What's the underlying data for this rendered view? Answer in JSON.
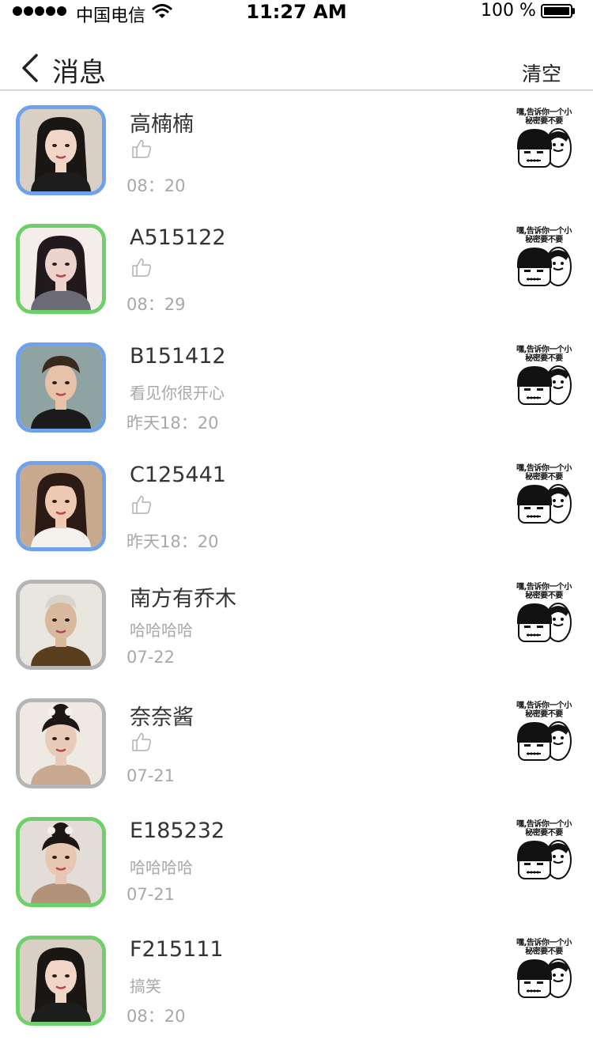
{
  "status_bar": {
    "carrier": "中国电信",
    "time": "11:27 AM",
    "battery": "100 %"
  },
  "nav": {
    "title": "消息",
    "clear_label": "清空"
  },
  "sticker_caption": "嘿,告诉你一个小秘密要不要",
  "colors": {
    "frame_blue": "#6fa2ea",
    "frame_green": "#6fcf6a",
    "frame_gray": "#b5b5b5",
    "secondary_text": "#a8a8a8"
  },
  "messages": [
    {
      "name": "高楠楠",
      "preview": "",
      "preview_icon": "thumbs-up-icon",
      "time": "08：20",
      "frame": "blue"
    },
    {
      "name": "A515122",
      "preview": "",
      "preview_icon": "thumbs-up-icon",
      "time": "08：29",
      "frame": "green"
    },
    {
      "name": "B151412",
      "preview": "看见你很开心",
      "preview_icon": "",
      "time": "昨天18：20",
      "frame": "blue"
    },
    {
      "name": "C125441",
      "preview": "",
      "preview_icon": "thumbs-up-icon",
      "time": "昨天18：20",
      "frame": "blue"
    },
    {
      "name": "南方有乔木",
      "preview": "哈哈哈哈",
      "preview_icon": "",
      "time": "07-22",
      "frame": "gray"
    },
    {
      "name": "奈奈酱",
      "preview": "",
      "preview_icon": "thumbs-up-icon",
      "time": "07-21",
      "frame": "gray"
    },
    {
      "name": "E185232",
      "preview": "哈哈哈哈",
      "preview_icon": "",
      "time": "07-21",
      "frame": "green"
    },
    {
      "name": "F215111",
      "preview": "搞笑",
      "preview_icon": "",
      "time": "08：20",
      "frame": "green"
    }
  ]
}
